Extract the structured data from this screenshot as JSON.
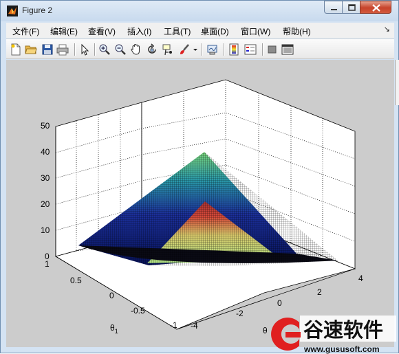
{
  "window": {
    "title": "Figure 2"
  },
  "menu": [
    {
      "label": "文件(F)"
    },
    {
      "label": "编辑(E)"
    },
    {
      "label": "查看(V)"
    },
    {
      "label": "插入(I)"
    },
    {
      "label": "工具(T)"
    },
    {
      "label": "桌面(D)"
    },
    {
      "label": "窗口(W)"
    },
    {
      "label": "帮助(H)"
    }
  ],
  "toolbar": {
    "icons": [
      "new-figure-icon",
      "open-file-icon",
      "save-icon",
      "print-icon",
      "edit-plot-arrow-icon",
      "zoom-in-icon",
      "zoom-out-icon",
      "pan-hand-icon",
      "rotate-3d-icon",
      "data-cursor-icon",
      "brush-icon",
      "dropdown-arrow-icon",
      "link-plot-icon",
      "colorbar-icon",
      "legend-icon",
      "hide-plot-tools-icon",
      "show-plot-tools-icon"
    ]
  },
  "plot": {
    "zticks": [
      "50",
      "40",
      "30",
      "20",
      "10",
      "0"
    ],
    "yticks": [
      "1",
      "0.5",
      "0",
      "-0.5",
      "-1"
    ],
    "xticks": [
      "-4",
      "-2",
      "0",
      "2",
      "4"
    ],
    "ylabel": "θ",
    "ylabel_sub": "1",
    "xlabel_partial": "θ"
  },
  "watermark": {
    "name": "谷速软件",
    "url": "www.gususoft.com"
  },
  "colors": {
    "titlebar": "#d4e3f3",
    "figure_bg": "#cccccc",
    "close_red": "#c7432b",
    "watermark_red": "#e02020"
  }
}
